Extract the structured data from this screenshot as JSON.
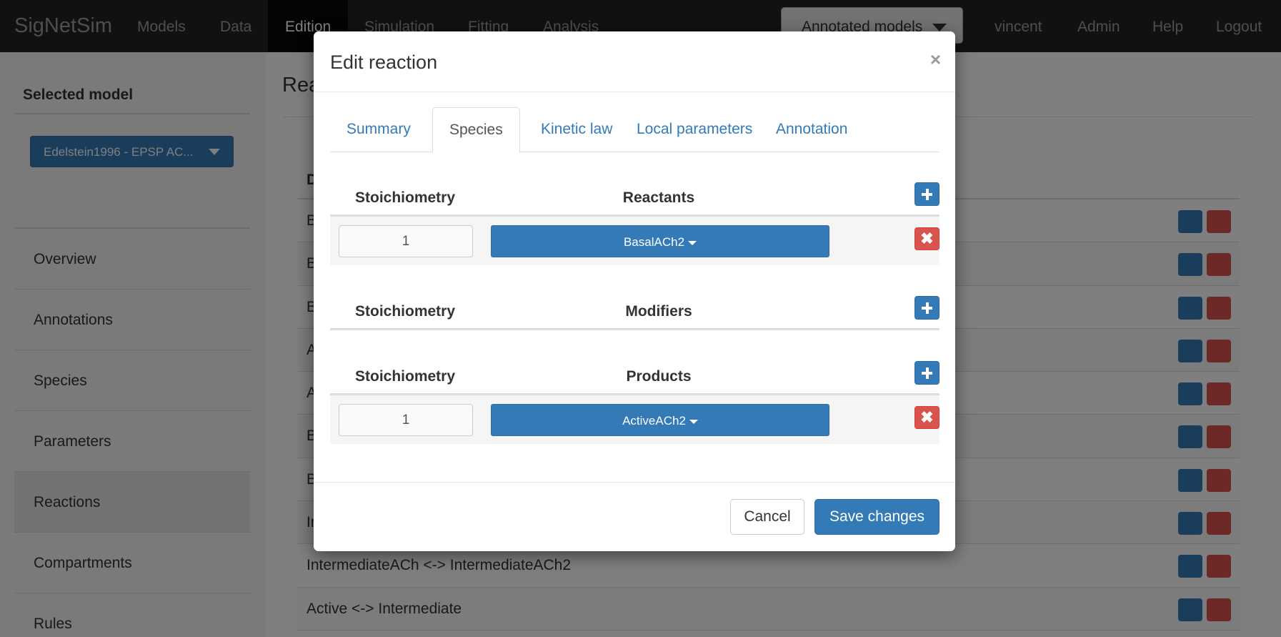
{
  "navbar": {
    "brand": "SigNetSim",
    "items": [
      {
        "label": "Models",
        "active": false
      },
      {
        "label": "Data",
        "active": false
      },
      {
        "label": "Edition",
        "active": true
      },
      {
        "label": "Simulation",
        "active": false
      },
      {
        "label": "Fitting",
        "active": false
      },
      {
        "label": "Analysis",
        "active": false
      }
    ],
    "models_dropdown": "Annotated models",
    "user": "vincent",
    "admin": "Admin",
    "help": "Help",
    "logout": "Logout"
  },
  "sidebar": {
    "selected_model_title": "Selected model",
    "model_button": "Edelstein1996 - EPSP AC...",
    "items": [
      {
        "label": "Overview",
        "active": false
      },
      {
        "label": "Annotations",
        "active": false
      },
      {
        "label": "Species",
        "active": false
      },
      {
        "label": "Parameters",
        "active": false
      },
      {
        "label": "Reactions",
        "active": true
      },
      {
        "label": "Compartments",
        "active": false
      },
      {
        "label": "Rules",
        "active": false
      }
    ]
  },
  "main": {
    "heading": "Rea",
    "table_header": "D",
    "rows": [
      "B",
      "B",
      "B",
      "A",
      "A",
      "B",
      "B",
      "In",
      "IntermediateACh <-> IntermediateACh2",
      "Active <-> Intermediate"
    ]
  },
  "modal": {
    "title": "Edit reaction",
    "close": "×",
    "tabs": [
      {
        "label": "Summary",
        "active": false
      },
      {
        "label": "Species",
        "active": true
      },
      {
        "label": "Kinetic law",
        "active": false
      },
      {
        "label": "Local parameters",
        "active": false
      },
      {
        "label": "Annotation",
        "active": false
      }
    ],
    "reactants": {
      "stoich_header": "Stoichiometry",
      "header": "Reactants",
      "rows": [
        {
          "stoich": "1",
          "species": "BasalACh2"
        }
      ]
    },
    "modifiers": {
      "stoich_header": "Stoichiometry",
      "header": "Modifiers",
      "rows": []
    },
    "products": {
      "stoich_header": "Stoichiometry",
      "header": "Products",
      "rows": [
        {
          "stoich": "1",
          "species": "ActiveACh2"
        }
      ]
    },
    "cancel": "Cancel",
    "save": "Save changes"
  },
  "colors": {
    "primary": "#337ab7",
    "danger": "#d9534f",
    "navbar": "#222222"
  }
}
